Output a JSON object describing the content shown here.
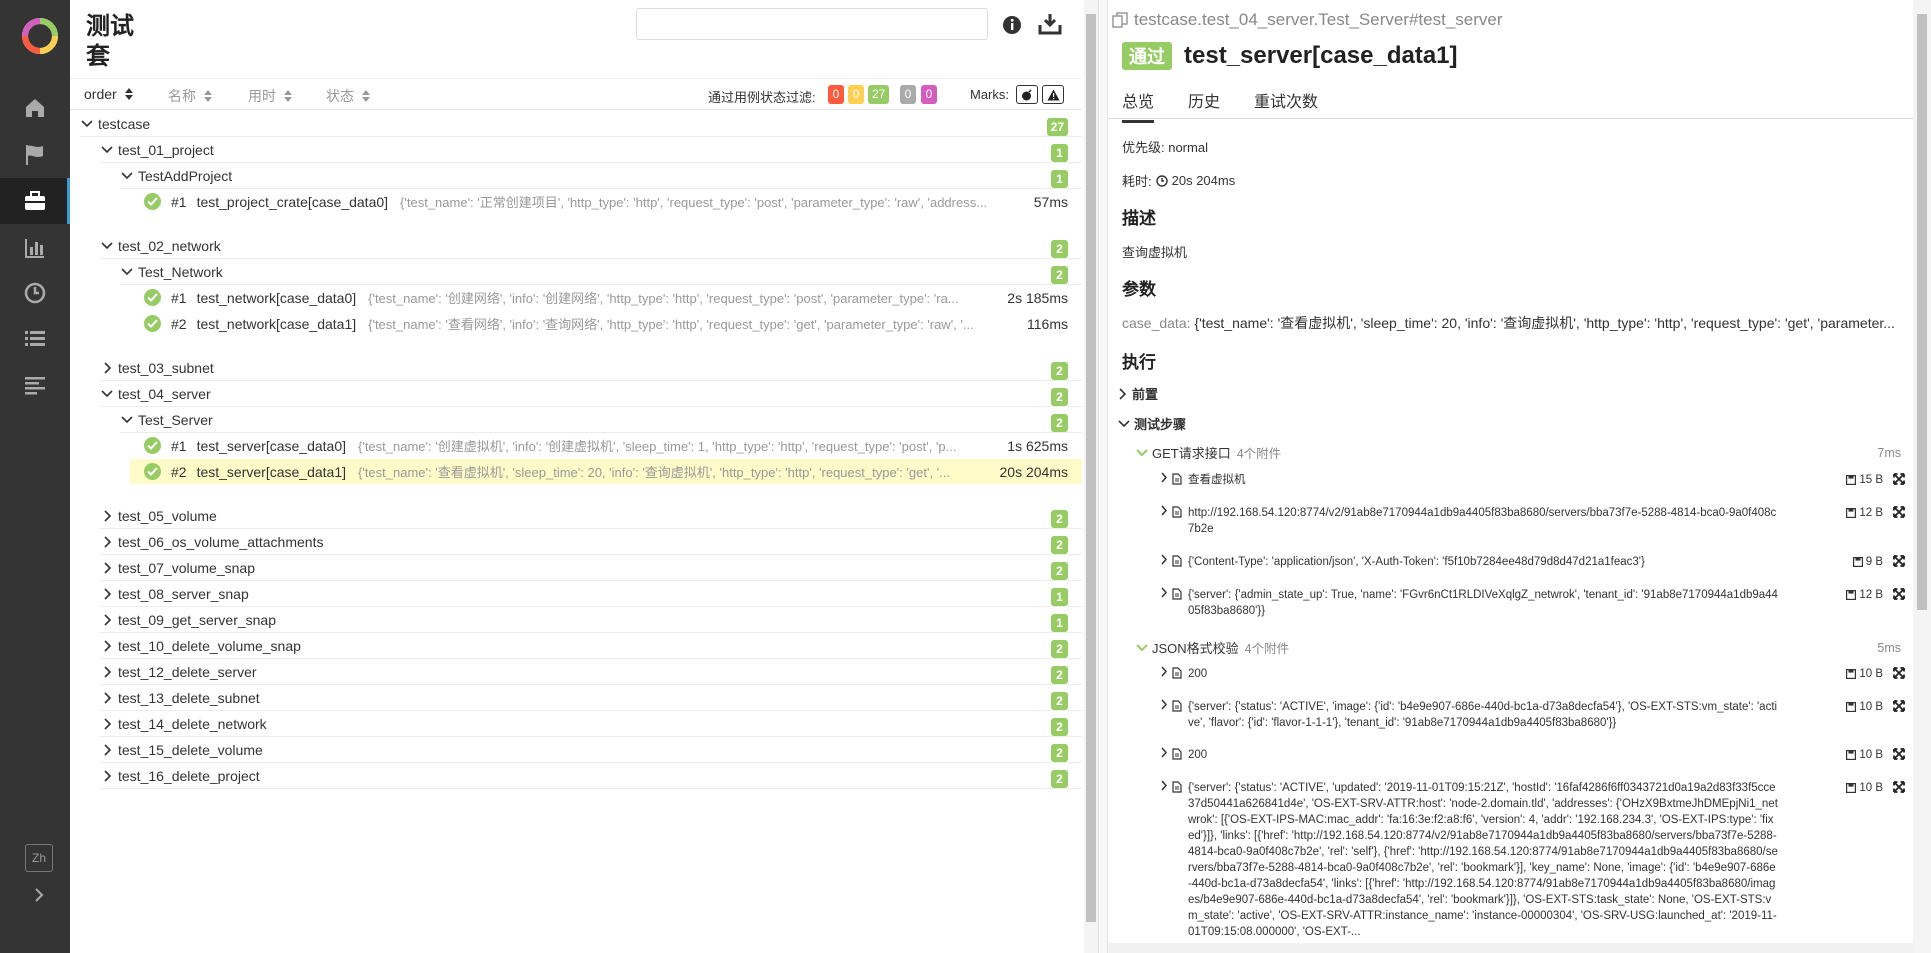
{
  "sidenav": {
    "items": [
      {
        "icon": "home-icon"
      },
      {
        "icon": "flag-icon"
      },
      {
        "icon": "briefcase-icon",
        "active": true
      },
      {
        "icon": "bar-chart-icon"
      },
      {
        "icon": "clock-icon"
      },
      {
        "icon": "list-icon"
      },
      {
        "icon": "align-left-icon"
      }
    ],
    "lang": "Zh"
  },
  "suites": {
    "title": "测试套",
    "search_placeholder": "",
    "sort": {
      "order": "order",
      "name": "名称",
      "duration": "用时",
      "status": "状态"
    },
    "filter_label": "通过用例状态过滤:",
    "filter_counts": [
      {
        "value": "0",
        "color": "#fd5a3e"
      },
      {
        "value": "0",
        "color": "#ffd050"
      },
      {
        "value": "27",
        "color": "#97cc64"
      },
      {
        "value": "0",
        "color": "#aaaaaa"
      },
      {
        "value": "0",
        "color": "#d35ebe"
      }
    ],
    "marks_label": "Marks:",
    "tree": [
      {
        "level": 0,
        "type": "group",
        "open": true,
        "name": "testcase",
        "count": "27"
      },
      {
        "level": 1,
        "type": "group",
        "open": true,
        "name": "test_01_project",
        "count": "1"
      },
      {
        "level": 2,
        "type": "group",
        "open": true,
        "name": "TestAddProject",
        "count": "1"
      },
      {
        "level": 3,
        "type": "leaf",
        "num": "#1",
        "name": "test_project_crate[case_data0]",
        "params": "{'test_name': '正常创建项目', 'http_type': 'http', 'request_type': 'post', 'parameter_type': 'raw', 'address...",
        "duration": "57ms"
      },
      {
        "level": 1,
        "type": "group",
        "open": true,
        "name": "test_02_network",
        "count": "2",
        "gap": true
      },
      {
        "level": 2,
        "type": "group",
        "open": true,
        "name": "Test_Network",
        "count": "2"
      },
      {
        "level": 3,
        "type": "leaf",
        "num": "#1",
        "name": "test_network[case_data0]",
        "params": "{'test_name': '创建网络', 'info': '创建网络', 'http_type': 'http', 'request_type': 'post', 'parameter_type': 'ra...",
        "duration": "2s 185ms"
      },
      {
        "level": 3,
        "type": "leaf",
        "num": "#2",
        "name": "test_network[case_data1]",
        "params": "{'test_name': '查看网络', 'info': '查询网络', 'http_type': 'http', 'request_type': 'get', 'parameter_type': 'raw', '...",
        "duration": "116ms"
      },
      {
        "level": 1,
        "type": "group",
        "open": false,
        "name": "test_03_subnet",
        "count": "2",
        "gap": true
      },
      {
        "level": 1,
        "type": "group",
        "open": true,
        "name": "test_04_server",
        "count": "2"
      },
      {
        "level": 2,
        "type": "group",
        "open": true,
        "name": "Test_Server",
        "count": "2"
      },
      {
        "level": 3,
        "type": "leaf",
        "num": "#1",
        "name": "test_server[case_data0]",
        "params": "{'test_name': '创建虚拟机', 'info': '创建虚拟机', 'sleep_time': 1, 'http_type': 'http', 'request_type': 'post', 'p...",
        "duration": "1s 625ms"
      },
      {
        "level": 3,
        "type": "leaf",
        "num": "#2",
        "name": "test_server[case_data1]",
        "params": "{'test_name': '查看虚拟机', 'sleep_time': 20, 'info': '查询虚拟机', 'http_type': 'http', 'request_type': 'get', '...",
        "duration": "20s 204ms",
        "selected": true
      },
      {
        "level": 1,
        "type": "group",
        "open": false,
        "name": "test_05_volume",
        "count": "2",
        "gap": true
      },
      {
        "level": 1,
        "type": "group",
        "open": false,
        "name": "test_06_os_volume_attachments",
        "count": "2"
      },
      {
        "level": 1,
        "type": "group",
        "open": false,
        "name": "test_07_volume_snap",
        "count": "2"
      },
      {
        "level": 1,
        "type": "group",
        "open": false,
        "name": "test_08_server_snap",
        "count": "1"
      },
      {
        "level": 1,
        "type": "group",
        "open": false,
        "name": "test_09_get_server_snap",
        "count": "1"
      },
      {
        "level": 1,
        "type": "group",
        "open": false,
        "name": "test_10_delete_volume_snap",
        "count": "2"
      },
      {
        "level": 1,
        "type": "group",
        "open": false,
        "name": "test_12_delete_server",
        "count": "2"
      },
      {
        "level": 1,
        "type": "group",
        "open": false,
        "name": "test_13_delete_subnet",
        "count": "2"
      },
      {
        "level": 1,
        "type": "group",
        "open": false,
        "name": "test_14_delete_network",
        "count": "2"
      },
      {
        "level": 1,
        "type": "group",
        "open": false,
        "name": "test_15_delete_volume",
        "count": "2"
      },
      {
        "level": 1,
        "type": "group",
        "open": false,
        "name": "test_16_delete_project",
        "count": "2"
      }
    ]
  },
  "detail": {
    "path": "testcase.test_04_server.Test_Server#test_server",
    "status": "通过",
    "title": "test_server[case_data1]",
    "tabs": [
      "总览",
      "历史",
      "重试次数"
    ],
    "priority": "优先级: normal",
    "duration_label": "耗时:",
    "duration": "20s 204ms",
    "desc_heading": "描述",
    "desc": "查询虚拟机",
    "params_heading": "参数",
    "param_key": "case_data:",
    "param_value": "{'test_name': '查看虚拟机', 'sleep_time': 20, 'info': '查询虚拟机', 'http_type': 'http', 'request_type': 'get', 'parameter...",
    "exec_heading": "执行",
    "setup_label": "前置",
    "steps_label": "测试步骤",
    "steps": [
      {
        "name": "GET请求接口",
        "attachments": "4个附件",
        "time": "7ms"
      },
      {
        "name": "JSON格式校验",
        "attachments": "4个附件",
        "time": "5ms"
      }
    ],
    "attachments": [
      {
        "text": "查看虚拟机",
        "size": "15 B"
      },
      {
        "text": "http://192.168.54.120:8774/v2/91ab8e7170944a1db9a4405f83ba8680/servers/bba73f7e-5288-4814-bca0-9a0f408c7b2e",
        "size": "12 B"
      },
      {
        "text": "{'Content-Type': 'application/json', 'X-Auth-Token': 'f5f10b7284ee48d79d8d47d21a1feac3'}",
        "size": "9 B"
      },
      {
        "text": "{'server': {'admin_state_up': True, 'name': 'FGvr6nCt1RLDIVeXqlgZ_netwrok', 'tenant_id': '91ab8e7170944a1db9a4405f83ba8680'}}",
        "size": "12 B"
      },
      {
        "text": "200",
        "size": "10 B"
      },
      {
        "text": "{'server': {'status': 'ACTIVE', 'image': {'id': 'b4e9e907-686e-440d-bc1a-d73a8decfa54'}, 'OS-EXT-STS:vm_state': 'active', 'flavor': {'id': 'flavor-1-1-1'}, 'tenant_id': '91ab8e7170944a1db9a4405f83ba8680'}}",
        "size": "10 B"
      },
      {
        "text": "200",
        "size": "10 B"
      },
      {
        "text": "{'server': {'status': 'ACTIVE', 'updated': '2019-11-01T09:15:21Z', 'hostId': '16faf4286f6ff0343721d0a19a2d83f33f5cce37d50441a626841d4e', 'OS-EXT-SRV-ATTR:host': 'node-2.domain.tld', 'addresses': {'OHzX9BxtmeJhDMEpjNi1_netwrok': [{'OS-EXT-IPS-MAC:mac_addr': 'fa:16:3e:f2:a8:f6', 'version': 4, 'addr': '192.168.234.3', 'OS-EXT-IPS:type': 'fixed'}]}, 'links': [{'href': 'http://192.168.54.120:8774/v2/91ab8e7170944a1db9a4405f83ba8680/servers/bba73f7e-5288-4814-bca0-9a0f408c7b2e', 'rel': 'self'}, {'href': 'http://192.168.54.120:8774/91ab8e7170944a1db9a4405f83ba8680/servers/bba73f7e-5288-4814-bca0-9a0f408c7b2e', 'rel': 'bookmark'}], 'key_name': None, 'image': {'id': 'b4e9e907-686e-440d-bc1a-d73a8decfa54', 'links': [{'href': 'http://192.168.54.120:8774/91ab8e7170944a1db9a4405f83ba8680/images/b4e9e907-686e-440d-bc1a-d73a8decfa54', 'rel': 'bookmark'}]}, 'OS-EXT-STS:task_state': None, 'OS-EXT-STS:vm_state': 'active', 'OS-EXT-SRV-ATTR:instance_name': 'instance-00000304', 'OS-SRV-USG:launched_at': '2019-11-01T09:15:08.000000', 'OS-EXT-...",
        "size": "10 B"
      }
    ]
  }
}
